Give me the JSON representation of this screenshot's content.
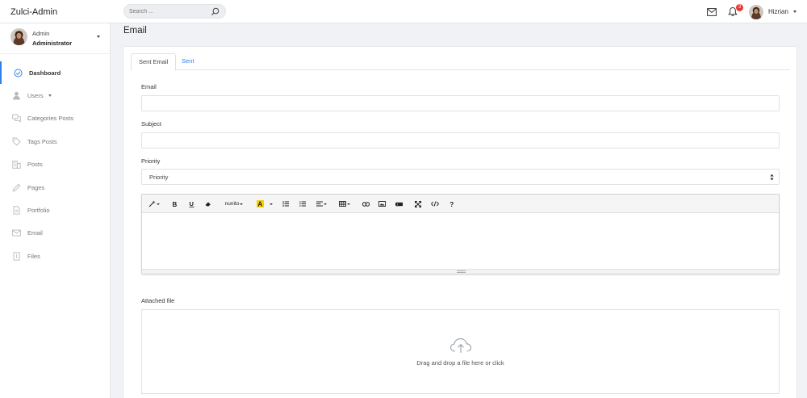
{
  "app": {
    "brand": "Zulci-Admin"
  },
  "search": {
    "placeholder": "Search ..."
  },
  "header": {
    "notification_count": "3",
    "username": "Hizrian"
  },
  "profile": {
    "name": "Admin",
    "role": "Administrator"
  },
  "sidebar": {
    "items": [
      {
        "label": "Dashboard",
        "icon": "dashboard-icon",
        "active": true
      },
      {
        "label": "Users",
        "icon": "user-icon",
        "has_submenu": true
      },
      {
        "label": "Categories Posts",
        "icon": "comments-icon"
      },
      {
        "label": "Tags Posts",
        "icon": "tag-icon"
      },
      {
        "label": "Posts",
        "icon": "building-icon"
      },
      {
        "label": "Pages",
        "icon": "pencil-icon"
      },
      {
        "label": "Portfolio",
        "icon": "document-icon"
      },
      {
        "label": "Email",
        "icon": "envelope-icon"
      },
      {
        "label": "Files",
        "icon": "file-icon"
      }
    ]
  },
  "page": {
    "title": "Email"
  },
  "tabs": [
    {
      "label": "Sent Email",
      "active": true
    },
    {
      "label": "Sent",
      "active": false
    }
  ],
  "form": {
    "email_label": "Email",
    "email_value": "",
    "subject_label": "Subject",
    "subject_value": "",
    "priority_label": "Priority",
    "priority_selected": "Priority",
    "editor_font": "nunito",
    "attached_label": "Attached file",
    "dropzone_text": "Drag and drop a file here or click"
  },
  "colors": {
    "accent": "#2f80ed",
    "badge": "#e53935",
    "background": "#f1f2f6",
    "highlight_color": "#f5d000"
  }
}
